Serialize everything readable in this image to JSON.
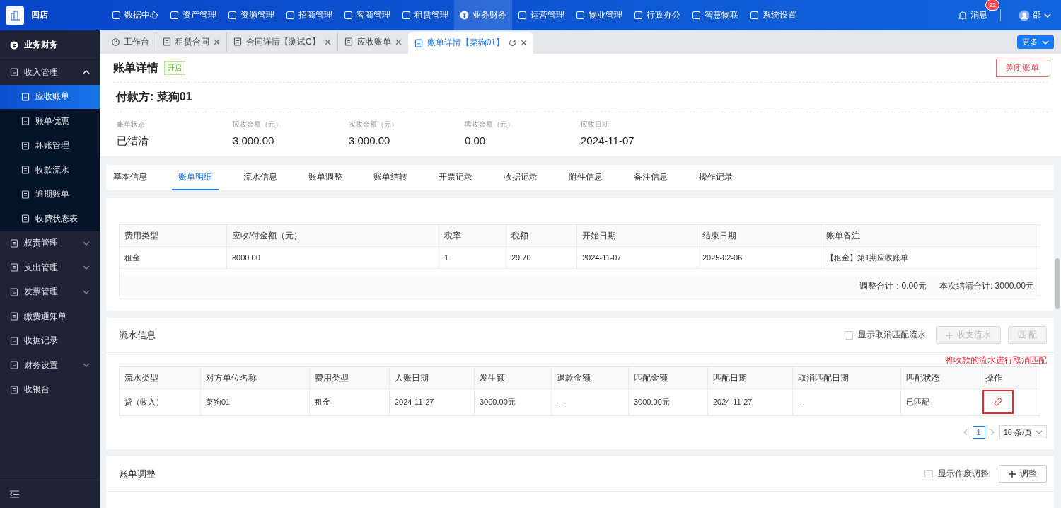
{
  "app": {
    "logo_text": "四店"
  },
  "top_nav": [
    {
      "label": "数据中心",
      "selected": false
    },
    {
      "label": "资产管理",
      "selected": false
    },
    {
      "label": "资源管理",
      "selected": false
    },
    {
      "label": "招商管理",
      "selected": false
    },
    {
      "label": "客商管理",
      "selected": false
    },
    {
      "label": "租赁管理",
      "selected": false
    },
    {
      "label": "业务财务",
      "selected": true
    },
    {
      "label": "运营管理",
      "selected": false
    },
    {
      "label": "物业管理",
      "selected": false
    },
    {
      "label": "行政办公",
      "selected": false
    },
    {
      "label": "智慧物联",
      "selected": false
    },
    {
      "label": "系统设置",
      "selected": false
    }
  ],
  "notifications": {
    "label": "消息",
    "badge": "22"
  },
  "user": {
    "name": "邵"
  },
  "sidebar": {
    "title": "业务财务",
    "items": [
      {
        "label": "收入管理",
        "kind": "group",
        "expanded": true,
        "children": [
          {
            "label": "应收账单",
            "selected": true
          },
          {
            "label": "账单优惠",
            "selected": false
          },
          {
            "label": "坏账管理",
            "selected": false
          },
          {
            "label": "收款流水",
            "selected": false
          },
          {
            "label": "逾期账单",
            "selected": false
          },
          {
            "label": "收费状态表",
            "selected": false
          }
        ]
      },
      {
        "label": "权责管理",
        "kind": "group",
        "expanded": false
      },
      {
        "label": "支出管理",
        "kind": "group",
        "expanded": false
      },
      {
        "label": "发票管理",
        "kind": "group",
        "expanded": false
      },
      {
        "label": "缴费通知单",
        "kind": "link"
      },
      {
        "label": "收据记录",
        "kind": "link"
      },
      {
        "label": "财务设置",
        "kind": "group",
        "expanded": false
      },
      {
        "label": "收银台",
        "kind": "link"
      }
    ]
  },
  "tabs": [
    {
      "label": "工作台",
      "selected": false,
      "closable": false
    },
    {
      "label": "租赁合同",
      "selected": false,
      "closable": true
    },
    {
      "label": "合同详情【测试C】",
      "selected": false,
      "closable": true
    },
    {
      "label": "应收账单",
      "selected": false,
      "closable": true
    },
    {
      "label": "账单详情【菜狗01】",
      "selected": true,
      "closable": true
    }
  ],
  "more_button": "更多",
  "page": {
    "title": "账单详情",
    "status_tag": "开启",
    "close_button": "关闭账单",
    "payer": "付款方: 菜狗01",
    "stats": [
      {
        "label": "账单状态",
        "value": "已结清"
      },
      {
        "label": "应收金额（元）",
        "value": "3,000.00"
      },
      {
        "label": "实收金额（元）",
        "value": "3,000.00"
      },
      {
        "label": "需收金额（元）",
        "value": "0.00"
      },
      {
        "label": "应收日期",
        "value": "2024-11-07"
      }
    ]
  },
  "detail_tabs": [
    {
      "label": "基本信息",
      "selected": false
    },
    {
      "label": "账单明细",
      "selected": true
    },
    {
      "label": "流水信息",
      "selected": false
    },
    {
      "label": "账单调整",
      "selected": false
    },
    {
      "label": "账单结转",
      "selected": false
    },
    {
      "label": "开票记录",
      "selected": false
    },
    {
      "label": "收据记录",
      "selected": false
    },
    {
      "label": "附件信息",
      "selected": false
    },
    {
      "label": "备注信息",
      "selected": false
    },
    {
      "label": "操作记录",
      "selected": false
    }
  ],
  "bill_detail": {
    "columns": [
      "费用类型",
      "应收/付金额（元）",
      "税率",
      "税额",
      "开始日期",
      "结束日期",
      "账单备注"
    ],
    "rows": [
      [
        "租金",
        "3000.00",
        "1",
        "29.70",
        "2024-11-07",
        "2025-02-06",
        "【租金】第1期应收账单"
      ]
    ],
    "summary": [
      "调整合计：0.00元",
      "本次结清合计: 3000.00元"
    ]
  },
  "flow": {
    "title": "流水信息",
    "checkbox": {
      "label": "显示取消匹配流水",
      "checked": false
    },
    "buttons": [
      {
        "label": "收支流水",
        "kind": "add",
        "disabled": true
      },
      {
        "label": "匹 配",
        "kind": "plain",
        "disabled": true
      }
    ],
    "annotation": "将收款的流水进行取消匹配",
    "columns": [
      "流水类型",
      "对方单位名称",
      "费用类型",
      "入账日期",
      "发生额",
      "退款金额",
      "匹配金额",
      "匹配日期",
      "取消匹配日期",
      "匹配状态",
      "操作"
    ],
    "rows": [
      [
        "贷（收入）",
        "菜狗01",
        "租金",
        "2024-11-27",
        "3000.00元",
        "--",
        "3000.00元",
        "2024-11-27",
        "--",
        "已匹配"
      ]
    ],
    "pagination": {
      "page": "1",
      "page_size": "10 条/页"
    }
  },
  "adjustment": {
    "title": "账单调整",
    "checkbox": {
      "label": "显示作废调整",
      "checked": false
    },
    "button": "调整"
  }
}
